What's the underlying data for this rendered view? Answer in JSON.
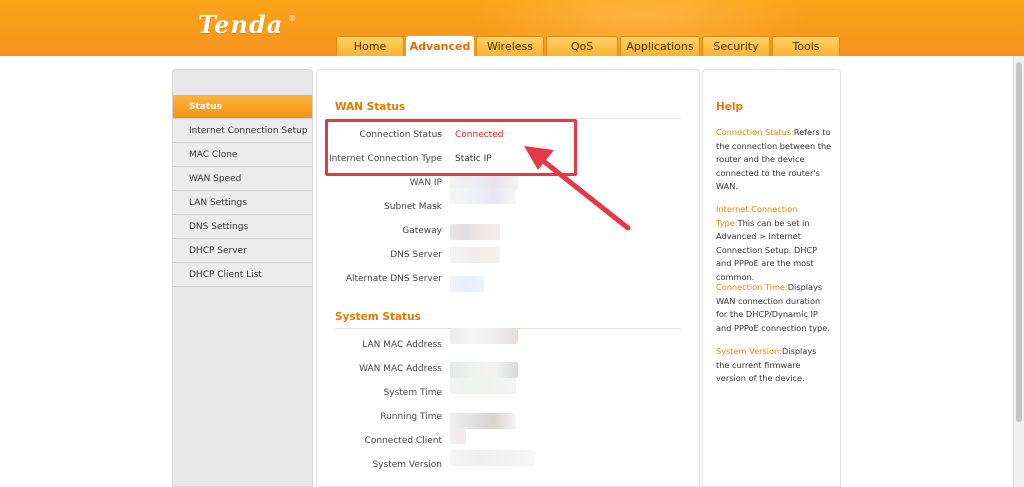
{
  "header": {
    "logo": "Tenda",
    "tabs": [
      {
        "label": "Home",
        "active": false
      },
      {
        "label": "Advanced",
        "active": true
      },
      {
        "label": "Wireless",
        "active": false
      },
      {
        "label": "QoS",
        "active": false
      },
      {
        "label": "Applications",
        "active": false
      },
      {
        "label": "Security",
        "active": false
      },
      {
        "label": "Tools",
        "active": false
      }
    ]
  },
  "sidebar": {
    "items": [
      {
        "label": "Status",
        "active": true
      },
      {
        "label": "Internet Connection Setup",
        "active": false
      },
      {
        "label": "MAC Clone",
        "active": false
      },
      {
        "label": "WAN Speed",
        "active": false
      },
      {
        "label": "LAN Settings",
        "active": false
      },
      {
        "label": "DNS Settings",
        "active": false
      },
      {
        "label": "DHCP Server",
        "active": false
      },
      {
        "label": "DHCP Client List",
        "active": false
      }
    ]
  },
  "wan_status": {
    "title": "WAN Status",
    "rows": [
      {
        "label": "Connection Status",
        "value": "Connected"
      },
      {
        "label": "Internet Connection Type",
        "value": "Static IP"
      },
      {
        "label": "WAN IP",
        "value": ""
      },
      {
        "label": "Subnet Mask",
        "value": ""
      },
      {
        "label": "Gateway",
        "value": ""
      },
      {
        "label": "DNS Server",
        "value": ""
      },
      {
        "label": "Alternate DNS Server",
        "value": ""
      }
    ]
  },
  "system_status": {
    "title": "System Status",
    "rows": [
      {
        "label": "LAN MAC Address",
        "value": ""
      },
      {
        "label": "WAN MAC Address",
        "value": ""
      },
      {
        "label": "System Time",
        "value": ""
      },
      {
        "label": "Running Time",
        "value": ""
      },
      {
        "label": "Connected Client",
        "value": ""
      },
      {
        "label": "System Version",
        "value": ""
      }
    ]
  },
  "help": {
    "title": "Help",
    "entries": [
      {
        "term": "Connection Status:",
        "text": "Refers to the connection between the router and the device connected to the router's WAN."
      },
      {
        "term": "Internet Connection Type:",
        "text": "This can be set in Advanced > Internet Connection Setup. DHCP and PPPoE are the most common."
      },
      {
        "term": "Connection Time:",
        "text": "Displays WAN connection duration for the DHCP/Dynamic IP and PPPoE connection type."
      },
      {
        "term": "System Version:",
        "text": "Displays the current firmware version of the device."
      }
    ]
  },
  "colors": {
    "brand_orange": "#f7931e",
    "section_title": "#e07b00",
    "connected": "#e02020",
    "annotation": "#e53848"
  }
}
